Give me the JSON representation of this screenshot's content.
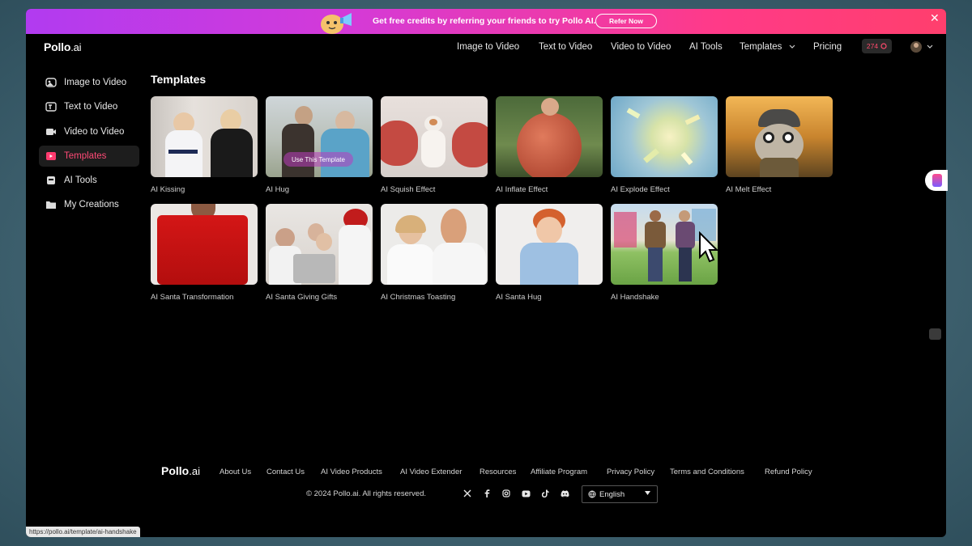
{
  "banner": {
    "text": "Get free credits by referring your friends to try Pollo AI.",
    "button": "Refer Now",
    "close": "✕"
  },
  "header": {
    "logo_main": "Pollo",
    "logo_suffix": ".ai",
    "nav": [
      "Image to Video",
      "Text to Video",
      "Video to Video",
      "AI Tools",
      "Templates",
      "Pricing"
    ],
    "credits": "274"
  },
  "sidebar": {
    "items": [
      {
        "label": "Image to Video",
        "icon": "image-video-icon"
      },
      {
        "label": "Text to Video",
        "icon": "text-video-icon"
      },
      {
        "label": "Video to Video",
        "icon": "video-camera-icon"
      },
      {
        "label": "Templates",
        "icon": "templates-icon"
      },
      {
        "label": "AI Tools",
        "icon": "ai-tools-icon"
      },
      {
        "label": "My Creations",
        "icon": "folder-icon"
      }
    ]
  },
  "main": {
    "title": "Templates",
    "templates": [
      {
        "label": "AI Kissing"
      },
      {
        "label": "AI Hug",
        "overlay": "Use This Template"
      },
      {
        "label": "AI Squish Effect"
      },
      {
        "label": "AI Inflate Effect"
      },
      {
        "label": "AI Explode Effect"
      },
      {
        "label": "AI Melt Effect"
      },
      {
        "label": "AI Santa Transformation"
      },
      {
        "label": "AI Santa Giving Gifts"
      },
      {
        "label": "AI Christmas Toasting"
      },
      {
        "label": "AI Santa Hug"
      },
      {
        "label": "AI Handshake"
      }
    ]
  },
  "footer": {
    "logo_main": "Pollo",
    "logo_suffix": ".ai",
    "links": [
      "About Us",
      "Contact Us",
      "AI Video Products",
      "AI Video Extender",
      "Resources",
      "Affiliate Program",
      "Privacy Policy",
      "Terms and Conditions",
      "Refund Policy"
    ],
    "copyright": "© 2024 Pollo.ai. All rights reserved.",
    "language": "English"
  },
  "status_bar": {
    "url": "https://pollo.ai/template/ai-handshake"
  },
  "colors": {
    "accent": "#ff3a6e",
    "banner_start": "#b13bf0",
    "banner_end": "#ff3f6d"
  }
}
